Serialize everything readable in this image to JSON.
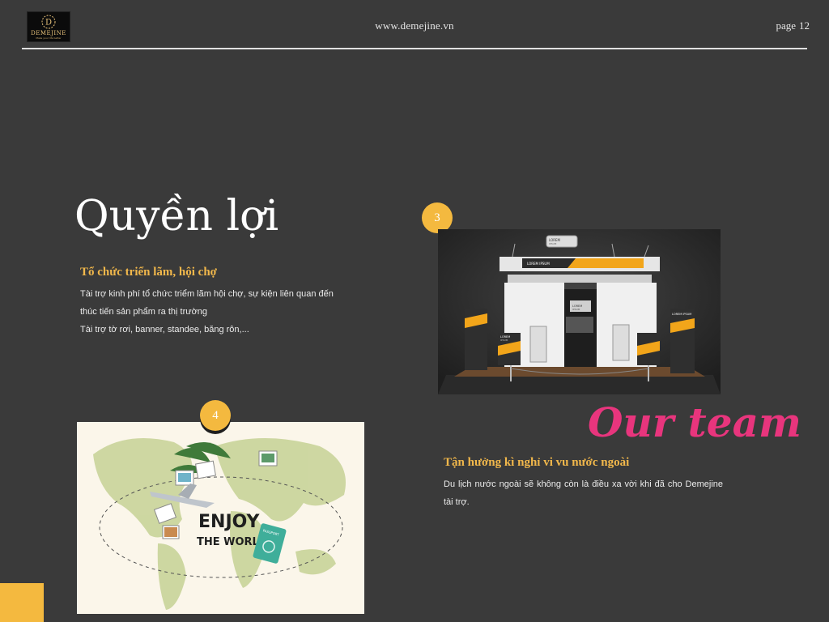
{
  "header": {
    "logo_text": "DEMEJINE",
    "logo_tagline": "Make your life better",
    "site_url": "www.demejine.vn",
    "page_label": "page",
    "page_number": "12"
  },
  "title": "Quyền lợi",
  "section3": {
    "badge": "3",
    "heading": "Tổ chức triển lãm, hội chợ",
    "lines": [
      "Tài trợ kinh phí tổ chức triểm lãm hội chợ, sự kiện liên quan đến",
      "thúc tiến sản phẩm ra thị trường",
      "Tài trợ tờ rơi, banner, standee, băng rôn,..."
    ],
    "image_labels": {
      "sign_top": "LOREM",
      "sign_top_sub": "IPSUM",
      "banner": "LOREM IPSUM",
      "banner_right": "LOREM IPSUM",
      "center_sign": "LOREM",
      "center_sign_sub": "IPSUM",
      "stand_label": "LOREM",
      "stand_label_sub": "IPSUM"
    }
  },
  "section4": {
    "badge": "4",
    "heading_script": "Our team",
    "heading": "Tận hưởng kì nghỉ vi vu nước ngoài",
    "body": "Du lịch nước ngoài sẽ không còn là điều xa vời khi đã cho Demejine tài trợ.",
    "image_text_line1": "ENJOY",
    "image_text_line2": "THE WORLD",
    "passport_label": "PASSPORT"
  },
  "colors": {
    "background": "#3a3a3a",
    "accent_yellow": "#f4b93f",
    "heading_gold": "#f2b84b",
    "pink": "#e8357d"
  }
}
